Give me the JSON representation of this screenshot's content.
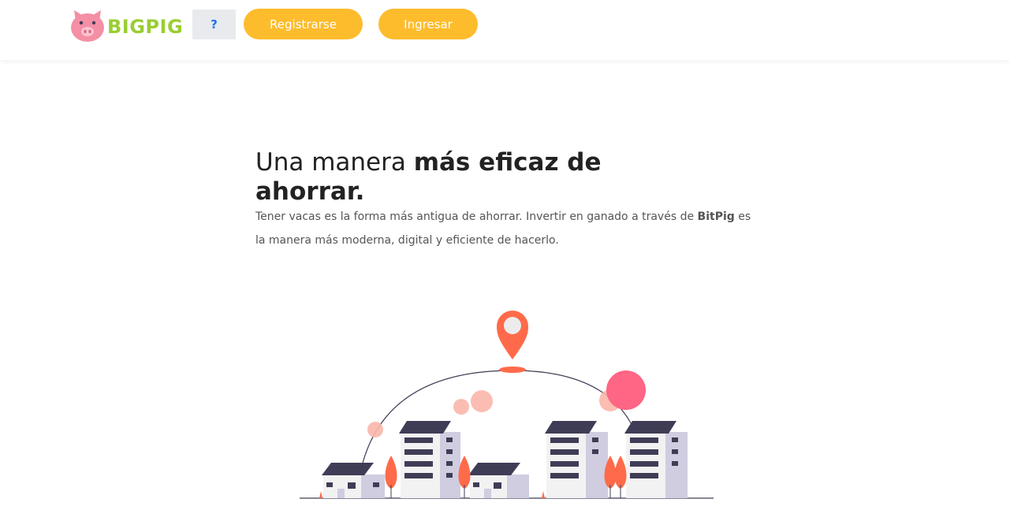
{
  "header": {
    "brand": "BIGPIG",
    "help_label": "?",
    "register_label": "Registrarse",
    "login_label": "Ingresar"
  },
  "hero": {
    "title_light": "Una manera ",
    "title_bold": "más eficaz de ahorrar.",
    "text_before": "Tener vacas es la forma más antigua de ahorrar. Invertir en ganado a través de ",
    "text_bold": "BitPig",
    "text_after": " es la manera más moderna, digital y eficiente de hacerlo."
  },
  "colors": {
    "accent": "#fdbc2c",
    "brand_green": "#9acd32",
    "pig_pink": "#f48fa5",
    "pin_red": "#ff6b4a",
    "building_dark": "#3f3d56"
  },
  "icons": {
    "logo": "pig-icon",
    "illustration": "city-location-illustration"
  }
}
